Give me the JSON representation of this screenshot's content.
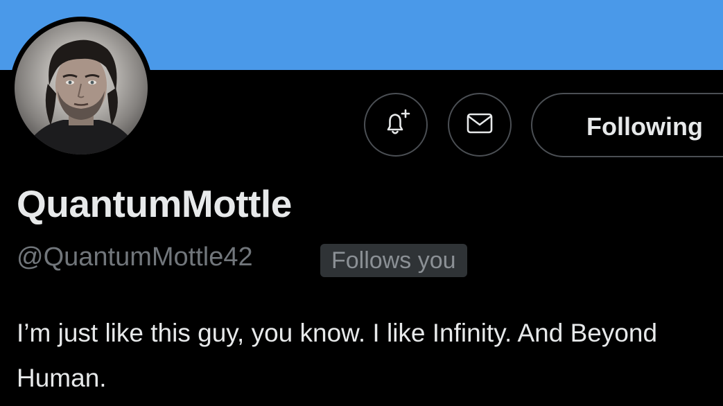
{
  "profile": {
    "display_name": "QuantumMottle",
    "handle": "@QuantumMottle42",
    "follows_you_badge": "Follows you",
    "bio": "I’m just like this guy, you know. I like Infinity. And Beyond Human."
  },
  "actions": {
    "notify_icon": "bell-plus-icon",
    "message_icon": "envelope-icon",
    "following_label": "Following"
  },
  "colors": {
    "banner": "#4a99e9",
    "background": "#000000",
    "text_primary": "#e7e9ea",
    "text_secondary": "#71767b",
    "button_border": "#4b4f54",
    "badge_background": "#2f3336"
  }
}
